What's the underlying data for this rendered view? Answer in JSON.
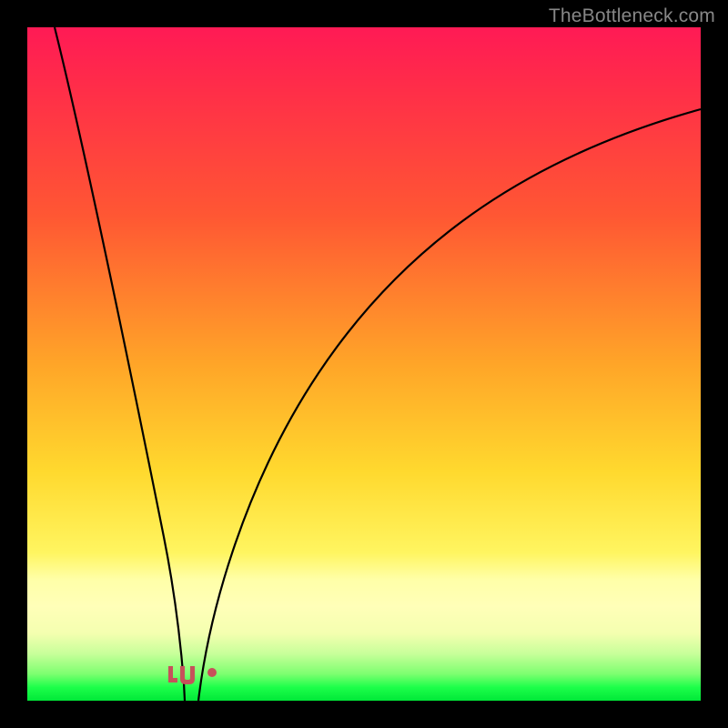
{
  "watermark": "TheBottleneck.com",
  "chart_data": {
    "type": "line",
    "title": "",
    "xlabel": "",
    "ylabel": "",
    "xlim": [
      0,
      100
    ],
    "ylim": [
      0,
      100
    ],
    "grid": false,
    "legend": false,
    "background_gradient": {
      "stops": [
        {
          "pct": 0,
          "color": "#ff1a55"
        },
        {
          "pct": 28,
          "color": "#ff5733"
        },
        {
          "pct": 50,
          "color": "#ffa528"
        },
        {
          "pct": 78,
          "color": "#fff560"
        },
        {
          "pct": 90,
          "color": "#f4ffb0"
        },
        {
          "pct": 100,
          "color": "#00e838"
        }
      ]
    },
    "series": [
      {
        "name": "left-curve",
        "x": [
          4,
          6,
          8,
          10,
          12,
          14,
          16,
          18,
          20,
          21,
          22,
          23
        ],
        "y": [
          100,
          89,
          78,
          67,
          56,
          44,
          33,
          22,
          11,
          5,
          2,
          0
        ]
      },
      {
        "name": "right-curve",
        "x": [
          25,
          27,
          30,
          34,
          38,
          44,
          50,
          58,
          66,
          76,
          88,
          100
        ],
        "y": [
          0,
          5,
          12,
          22,
          32,
          44,
          53,
          62,
          70,
          78,
          84,
          88
        ]
      }
    ],
    "markers": [
      {
        "name": "marker-L",
        "x": 21.0,
        "y": 2.5,
        "r": 1.2,
        "color": "#c6515a"
      },
      {
        "name": "marker-U-left",
        "x": 22.5,
        "y": 1.0,
        "r": 1.2,
        "color": "#c6515a"
      },
      {
        "name": "marker-U-right",
        "x": 24.5,
        "y": 1.0,
        "r": 1.2,
        "color": "#c6515a"
      },
      {
        "name": "marker-dot",
        "x": 27.5,
        "y": 3.5,
        "r": 0.9,
        "color": "#c6515a"
      }
    ]
  }
}
